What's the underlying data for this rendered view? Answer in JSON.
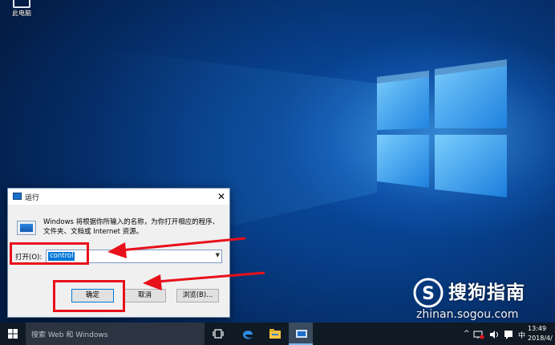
{
  "desktop": {
    "icons": [
      {
        "label": "此电脑",
        "icon": "this-pc-icon"
      }
    ]
  },
  "run_dialog": {
    "title": "运行",
    "description_line1": "Windows 将根据你所输入的名称，为你打开相应的程序、",
    "description_line2": "文件夹、文档或 Internet 资源。",
    "open_label": "打开(O):",
    "input_value": "control",
    "ok_label": "确定",
    "cancel_label": "取消",
    "browse_label": "浏览(B)..."
  },
  "watermark": {
    "logo_letter": "S",
    "brand": "搜狗指南",
    "url": "zhinan.sogou.com"
  },
  "taskbar": {
    "search_placeholder": "搜索 Web 和 Windows",
    "apps": [
      "task-view-icon",
      "edge-icon",
      "file-explorer-icon",
      "run-app-icon"
    ],
    "tray": {
      "chevron": "^",
      "ime": "中",
      "time": "13:49",
      "date": "2018/4/"
    }
  },
  "colors": {
    "annotation_red": "#e8101a",
    "selection_blue": "#0078d7",
    "taskbar_bg": "#101a24",
    "wallpaper_blue": "#0a4ea8"
  }
}
